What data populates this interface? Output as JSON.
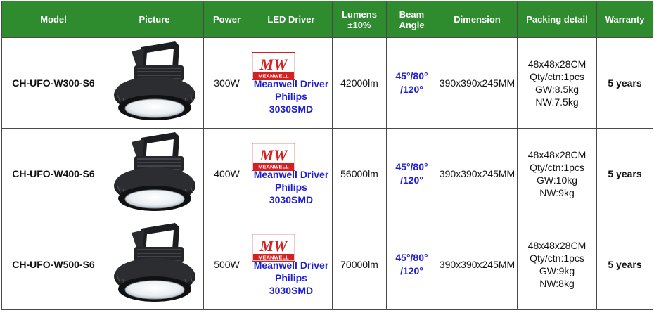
{
  "headers": {
    "model": "Model",
    "picture": "Picture",
    "power": "Power",
    "led_driver": "LED Driver",
    "lumens_line1": "Lumens",
    "lumens_line2": "±10%",
    "beam_line1": "Beam",
    "beam_line2": "Angle",
    "dimension": "Dimension",
    "packing": "Packing detail",
    "warranty": "Warranty"
  },
  "header_color": "#2e8b2e",
  "accent_blue": "#1f1fd0",
  "logo": {
    "mark": "MW",
    "text": "MEANWELL",
    "color": "#d42020"
  },
  "rows": [
    {
      "model": "CH-UFO-W300-S6",
      "power": "300W",
      "driver_line1": "Meanwell Driver",
      "driver_line2": "Philips",
      "driver_line3": "3030SMD",
      "lumens": "42000lm",
      "beam_line1": "45°/80°",
      "beam_line2": "/120°",
      "dimension": "390x390x245MM",
      "packing_line1": "48x48x28CM",
      "packing_line2": "Qty/ctn:1pcs",
      "packing_line3": "GW:8.5kg",
      "packing_line4": "NW:7.5kg",
      "warranty": "5 years"
    },
    {
      "model": "CH-UFO-W400-S6",
      "power": "400W",
      "driver_line1": "Meanwell Driver",
      "driver_line2": "Philips",
      "driver_line3": "3030SMD",
      "lumens": "56000lm",
      "beam_line1": "45°/80°",
      "beam_line2": "/120°",
      "dimension": "390x390x245MM",
      "packing_line1": "48x48x28CM",
      "packing_line2": "Qty/ctn:1pcs",
      "packing_line3": "GW:10kg",
      "packing_line4": "NW:9kg",
      "warranty": "5 years"
    },
    {
      "model": "CH-UFO-W500-S6",
      "power": "500W",
      "driver_line1": "Meanwell Driver",
      "driver_line2": "Philips",
      "driver_line3": "3030SMD",
      "lumens": "70000lm",
      "beam_line1": "45°/80°",
      "beam_line2": "/120°",
      "dimension": "390x390x245MM",
      "packing_line1": "48x48x28CM",
      "packing_line2": "Qty/ctn:1pcs",
      "packing_line3": "GW:9kg",
      "packing_line4": "NW:8kg",
      "warranty": "5 years"
    }
  ]
}
